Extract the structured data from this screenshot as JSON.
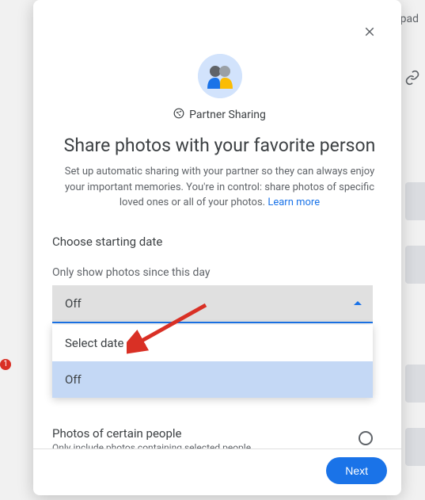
{
  "background": {
    "upload_text": "pad",
    "badge": "1"
  },
  "modal": {
    "label": "Partner Sharing",
    "heading": "Share photos with your favorite person",
    "description": "Set up automatic sharing with your partner so they can always enjoy your important memories. You're in control: share photos of specific loved ones or all of your photos. ",
    "learn_more": "Learn more",
    "section_date_title": "Choose starting date",
    "date_field_label": "Only show photos since this day",
    "date_selected": "Off",
    "date_options": {
      "select_date": "Select date",
      "off": "Off"
    },
    "people_title": "Photos of certain people",
    "people_sub": "Only include photos containing selected people",
    "next": "Next"
  }
}
